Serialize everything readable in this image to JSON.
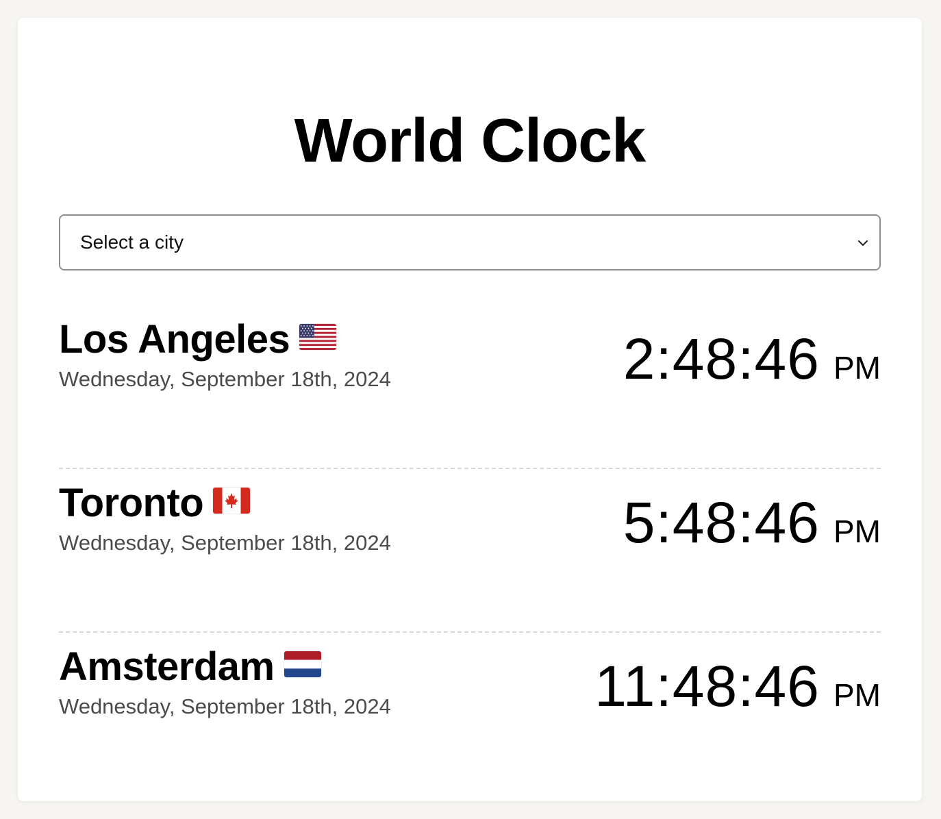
{
  "page": {
    "title": "World Clock"
  },
  "city_select": {
    "value": "Select a city",
    "icon": "chevron-down-icon"
  },
  "clocks": [
    {
      "city": "Los Angeles",
      "flag": "us-flag-icon",
      "date": "Wednesday, September 18th, 2024",
      "time": "2:48:46",
      "ampm": "PM"
    },
    {
      "city": "Toronto",
      "flag": "canada-flag-icon",
      "date": "Wednesday, September 18th, 2024",
      "time": "5:48:46",
      "ampm": "PM"
    },
    {
      "city": "Amsterdam",
      "flag": "netherlands-flag-icon",
      "date": "Wednesday, September 18th, 2024",
      "time": "11:48:46",
      "ampm": "PM"
    }
  ],
  "colors": {
    "background": "#f7f5f1",
    "card": "#ffffff",
    "date_text": "#4b4b4b",
    "divider": "#d8d8d8",
    "select_border": "#8e8e8e"
  }
}
